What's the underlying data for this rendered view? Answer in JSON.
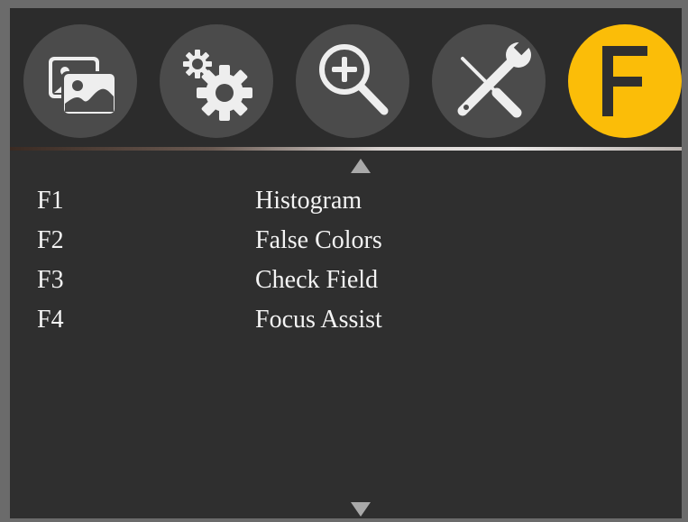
{
  "menu": {
    "tabs": [
      {
        "name": "images-icon",
        "active": false
      },
      {
        "name": "settings-gears-icon",
        "active": false
      },
      {
        "name": "zoom-in-icon",
        "active": false
      },
      {
        "name": "tools-icon",
        "active": false
      },
      {
        "name": "function-f-icon",
        "label": "F",
        "active": true
      }
    ],
    "accent_color": "#fbbd08",
    "scroll_up": "up-arrow-icon",
    "scroll_down": "down-arrow-icon"
  },
  "functions": [
    {
      "key": "F1",
      "label": "Histogram"
    },
    {
      "key": "F2",
      "label": "False Colors"
    },
    {
      "key": "F3",
      "label": "Check Field"
    },
    {
      "key": "F4",
      "label": "Focus Assist"
    }
  ]
}
